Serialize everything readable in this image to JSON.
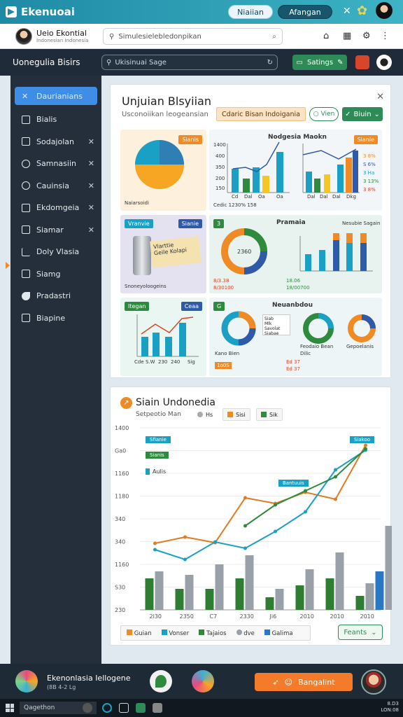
{
  "topbar": {
    "brand": "Ekenuoai",
    "pill1": "Niaiian",
    "pill2": "Afangan"
  },
  "userbar": {
    "name": "Ueio Ekontial",
    "subtitle": "Indonesian Indonesia",
    "search_placeholder": "Simulesielebledonpikan"
  },
  "appbar": {
    "title": "Uonegulia Bisirs",
    "search_placeholder": "Ukisinuai Sage",
    "save_label": "Satings"
  },
  "sidebar": {
    "items": [
      {
        "label": "Daurianians",
        "active": true,
        "closable": false
      },
      {
        "label": "Bialis",
        "closable": false
      },
      {
        "label": "Sodajolan",
        "closable": true
      },
      {
        "label": "Samnasiin",
        "closable": true
      },
      {
        "label": "Cauinsia",
        "closable": true
      },
      {
        "label": "Ekdomgeia",
        "closable": true
      },
      {
        "label": "Siamar",
        "closable": true
      },
      {
        "label": "Doly Vlasia",
        "closable": false
      },
      {
        "label": "Siamg",
        "closable": false
      },
      {
        "label": "Pradastri",
        "closable": false
      },
      {
        "label": "Biapine",
        "closable": false
      }
    ]
  },
  "panel": {
    "title": "Unjuian Blsyiian",
    "subtitle": "Usconoiikan leogeansian",
    "filter": "Cdaric Bisan Indoigania",
    "view_label": "Vien",
    "blue_label": "Biuin",
    "tiles": {
      "pie_tag": "Sianis",
      "pie_caption": "Naiarsoidi",
      "bar1_title": "Nodgesia Maokn",
      "bar1_tag": "Sianie",
      "bar1_axis": [
        "1400",
        "400",
        "350",
        "200",
        "150"
      ],
      "bar1_footer": "Cedic   1230%  158",
      "bar1_xlabels": [
        "Cd",
        "Dal",
        "Oa",
        "Oa"
      ],
      "bar2_legend": [
        "3 8%",
        "S 6%",
        "3 Ha",
        "3 13%",
        "3 8%"
      ],
      "bar2_xlabels": [
        "Dal",
        "Dal",
        "Dal",
        "Dkg"
      ],
      "note_tag": "Vranvie",
      "note_tag2": "Sianie",
      "note_text_1": "Vlarttie",
      "note_text_2": "Geile Kolapi",
      "note_caption": "Snoneyoloogeins",
      "donut_tag": "3",
      "donut_title": "Pramaia",
      "donut_value": "2360",
      "donut_right": "Nesubie Sagain",
      "donut_footer1": "8/3.38",
      "donut_footer2": "8/30100",
      "donut_right_footer1": "18.06",
      "donut_right_footer2": "18/00700",
      "line_tag": "Itegan",
      "line_tag2": "Ceaa",
      "line_xlabels": [
        "Cde",
        "S.W",
        "230",
        "240",
        "Sig"
      ],
      "multi_tag": "G",
      "multi_title": "Neuanbdou",
      "multi_legend": [
        "Siab",
        "Mlk",
        "Savolat",
        "Siabae"
      ],
      "multi_c1": "Kano Bien",
      "multi_c2": "Feodaio Bean",
      "multi_c2b": "Dilic",
      "multi_c3": "Gepoelanis",
      "multi_foot1": "1o0S",
      "multi_foot2": "Ed 37",
      "multi_foot3": "Ed 37"
    }
  },
  "chart_card": {
    "title": "Siain Undonedia",
    "subtitle": "Setpeotio Man",
    "legend_top": [
      "Hs",
      "Sisi",
      "Sik"
    ],
    "callout_1": "Sfianie",
    "callout_2": "Sianis",
    "callout_3": "Aulis",
    "callout_4": "Bantuuis",
    "callout_5": "Siakoo",
    "footer_legend": [
      "Guian",
      "Vonser",
      "Tajaios",
      "dve",
      "Galima"
    ],
    "points_label": "Feants"
  },
  "chart_data": {
    "type": "bar",
    "title": "Siain Undonedia",
    "y_ticks": [
      "1400",
      "Ga0",
      "1160",
      "1180",
      "340",
      "340",
      "1160",
      "S30",
      "230"
    ],
    "x_ticks": [
      "2l30",
      "2350",
      "C7",
      "2330",
      "Ji6",
      "2010",
      "2010",
      "2010"
    ],
    "categories": [
      "2l30",
      "2350",
      "C7",
      "2330",
      "Ji6",
      "2010",
      "2010",
      "2010"
    ],
    "series": [
      {
        "name": "Guian",
        "kind": "bar",
        "color": "#2e7d32",
        "values": [
          45,
          30,
          30,
          45,
          18,
          35,
          45,
          20
        ]
      },
      {
        "name": "Vonser",
        "kind": "bar",
        "color": "#9aa0a8",
        "values": [
          55,
          50,
          65,
          78,
          30,
          58,
          82,
          38
        ]
      },
      {
        "name": "Tajaios",
        "kind": "bar",
        "color": "#2a78c5",
        "values": [
          0,
          0,
          0,
          0,
          0,
          0,
          0,
          55
        ]
      },
      {
        "name": "dve",
        "kind": "bar",
        "color": "#9aa0a8",
        "values": [
          0,
          0,
          0,
          0,
          0,
          0,
          0,
          120
        ]
      },
      {
        "name": "Galima",
        "kind": "line",
        "color": "#e07b22",
        "values": [
          95,
          104,
          96,
          160,
          152,
          168,
          158,
          235
        ]
      },
      {
        "name": "Galima",
        "kind": "line",
        "color": "#1aa0c4",
        "values": [
          86,
          72,
          97,
          88,
          112,
          140,
          200,
          228
        ]
      },
      {
        "name": "Galima",
        "kind": "line",
        "color": "#2e8b3e",
        "values": [
          0,
          0,
          0,
          120,
          150,
          170,
          190,
          230
        ]
      }
    ],
    "ylim": [
      0,
      260
    ]
  },
  "dock": {
    "title": "Ekenonlasia Iellogene",
    "subtitle": "(8B 4-2 Lg",
    "button": "Bangalint"
  },
  "taskbar": {
    "search": "Qagethon",
    "clock_1": "8.D3",
    "clock_2": "LON:08"
  }
}
